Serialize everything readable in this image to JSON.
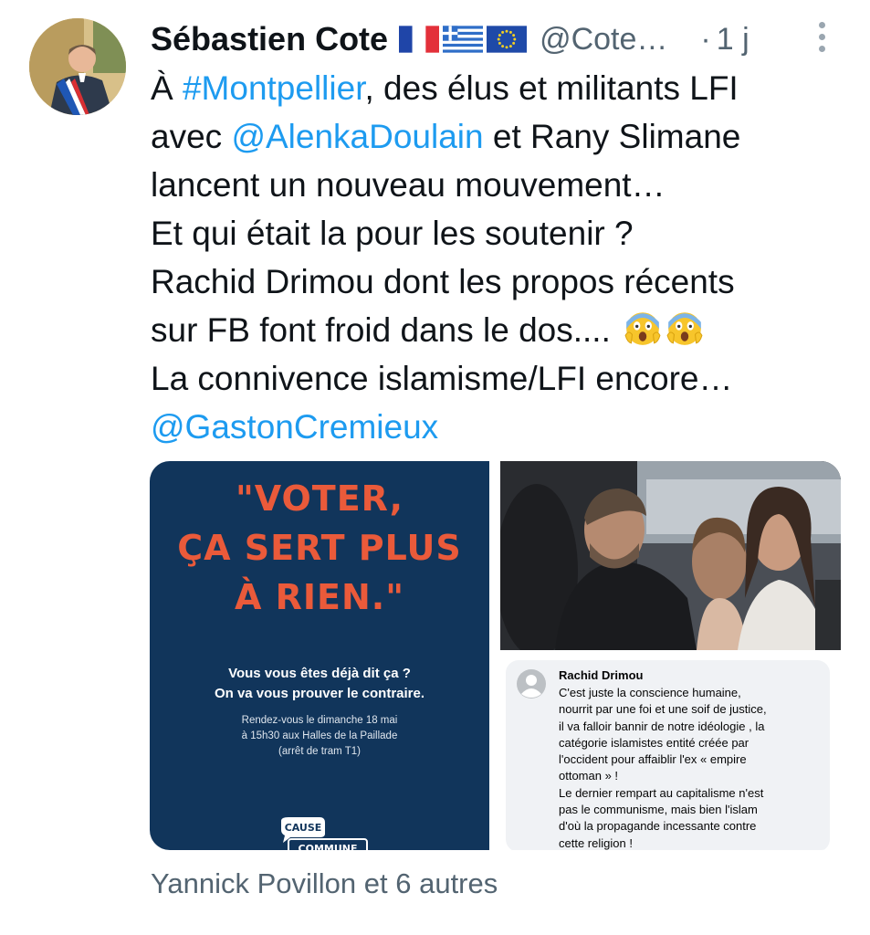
{
  "author": {
    "name": "Sébastien Cote",
    "handle": "@Cote…",
    "separator": "·",
    "time": "1 j",
    "flags": [
      "france-flag",
      "greece-flag",
      "eu-flag"
    ],
    "avatar_icon": "avatar-mayor-photo"
  },
  "tweet": {
    "lines": [
      {
        "pre": "À ",
        "link": "#Montpellier",
        "post": ", des élus et militants LFI"
      },
      {
        "pre": "avec ",
        "link": "@AlenkaDoulain",
        "post": " et Rany Slimane"
      },
      {
        "pre": "lancent un nouveau mouvement…",
        "link": "",
        "post": ""
      },
      {
        "pre": "Et qui était la pour les soutenir ?",
        "link": "",
        "post": ""
      },
      {
        "pre": "Rachid Drimou dont les propos récents",
        "link": "",
        "post": ""
      },
      {
        "pre": "sur FB font froid dans le dos.... ",
        "link": "",
        "post": ""
      },
      {
        "pre": "La connivence islamisme/LFI encore…",
        "link": "",
        "post": ""
      },
      {
        "pre": "",
        "link": "@GastonCremieux",
        "post": ""
      }
    ],
    "emoji": "screaming-face-emoji"
  },
  "media": {
    "poster": {
      "quote_lines": [
        "\"VOTER,",
        "ÇA SERT PLUS",
        "À RIEN.\""
      ],
      "sub_lines": [
        "Vous vous êtes déjà dit ça ?",
        "On va vous prouver le contraire."
      ],
      "info_lines": [
        "Rendez-vous le dimanche 18 mai",
        "à 15h30 aux Halles de la Paillade",
        "(arrêt de tram T1)"
      ],
      "logo_text_1": "CAUSE",
      "logo_text_2": "COMMUNE"
    },
    "fb_post": {
      "name": "Rachid Drimou",
      "lines": [
        "C'est juste la conscience humaine,",
        "nourrit par une foi et une soif de justice,",
        "il va falloir bannir de notre idéologie , la",
        "catégorie  islamistes entité créée par",
        "l'occident pour affaiblir l'ex « empire",
        "ottoman » !",
        "Le dernier rempart au capitalisme n'est",
        "pas le communisme, mais bien l'islam",
        "d'où la propagande incessante contre",
        "cette religion !"
      ]
    }
  },
  "liked_by": "Yannick Povillon et 6 autres",
  "colors": {
    "link": "#1d9bf0",
    "secondary": "#536471",
    "poster_bg": "#11355b",
    "poster_accent": "#ea5a3a"
  }
}
